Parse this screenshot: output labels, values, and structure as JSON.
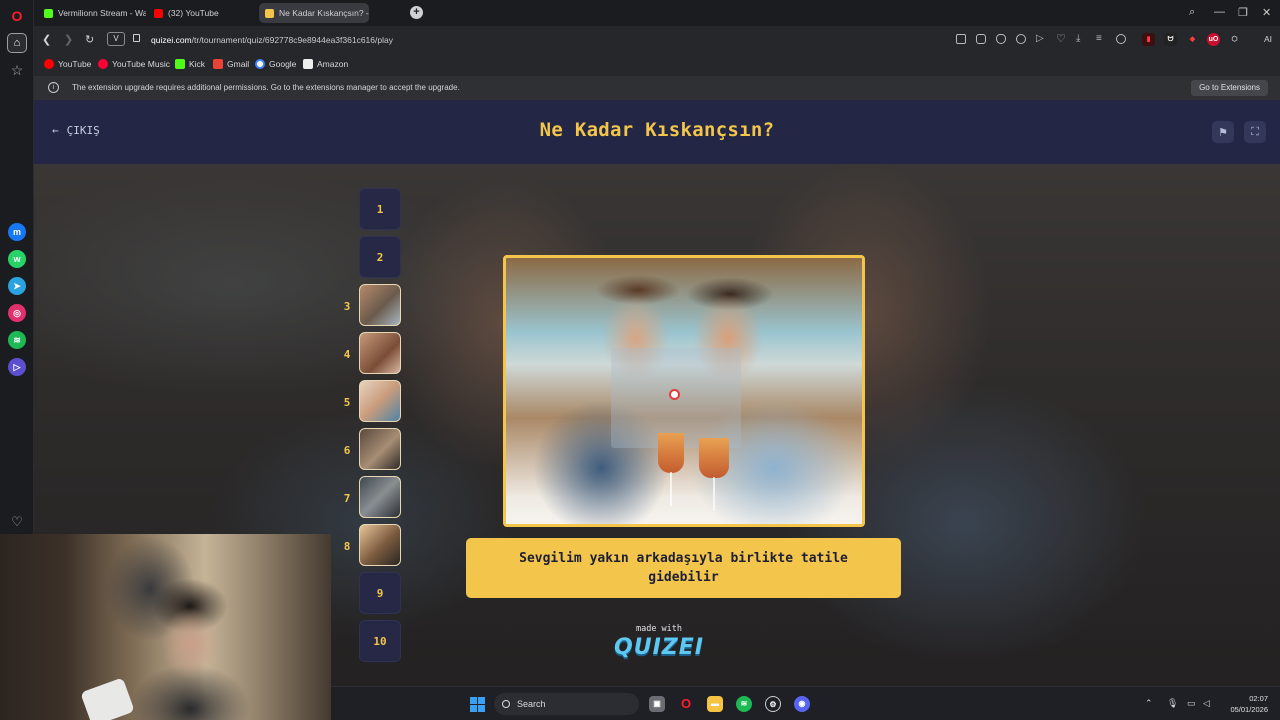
{
  "browser": {
    "tabs": [
      {
        "title": "Vermilionn Stream - Watc",
        "favicon_color": "#53fc18",
        "active": false
      },
      {
        "title": "(32) YouTube",
        "favicon_color": "#ff0000",
        "active": false
      },
      {
        "title": "Ne Kadar Kıskançsın? - Tir",
        "favicon_color": "#f3c64b",
        "active": true
      }
    ],
    "address": {
      "v_label": "V",
      "url_host": "quizei.com",
      "url_path": "/tr/tournament/quiz/692778c9e8944ea3f361c616/play"
    },
    "bookmarks": [
      {
        "label": "YouTube",
        "color": "#ff0000"
      },
      {
        "label": "YouTube Music",
        "color": "#ff0033"
      },
      {
        "label": "Kick",
        "color": "#53fc18"
      },
      {
        "label": "Gmail",
        "color": "#ea4335"
      },
      {
        "label": "Google",
        "color": "#4285f4"
      },
      {
        "label": "Amazon",
        "color": "#ffffff"
      }
    ],
    "infobar": {
      "message": "The extension upgrade requires additional permissions. Go to the extensions manager to accept the upgrade.",
      "button": "Go to Extensions"
    },
    "extension_badge": "uO",
    "ai_label": "AI"
  },
  "quiz": {
    "back_label": "ÇIKIŞ",
    "title": "Ne Kadar Kıskançsın?",
    "rounds": [
      {
        "num": "1",
        "thumb": false
      },
      {
        "num": "2",
        "thumb": false
      },
      {
        "num": "3",
        "thumb": true
      },
      {
        "num": "4",
        "thumb": true
      },
      {
        "num": "5",
        "thumb": true
      },
      {
        "num": "6",
        "thumb": true
      },
      {
        "num": "7",
        "thumb": true
      },
      {
        "num": "8",
        "thumb": true
      },
      {
        "num": "9",
        "thumb": false
      },
      {
        "num": "10",
        "thumb": false
      }
    ],
    "prompt": "Sevgilim yakın arkadaşıyla birlikte tatile gidebilir",
    "made_with": "made with",
    "brand": "QUIZEI",
    "accent": "#f3c64b",
    "header_bg": "#232645"
  },
  "taskbar": {
    "search_placeholder": "Search",
    "time": "02:07",
    "date": "05/01/2026"
  }
}
